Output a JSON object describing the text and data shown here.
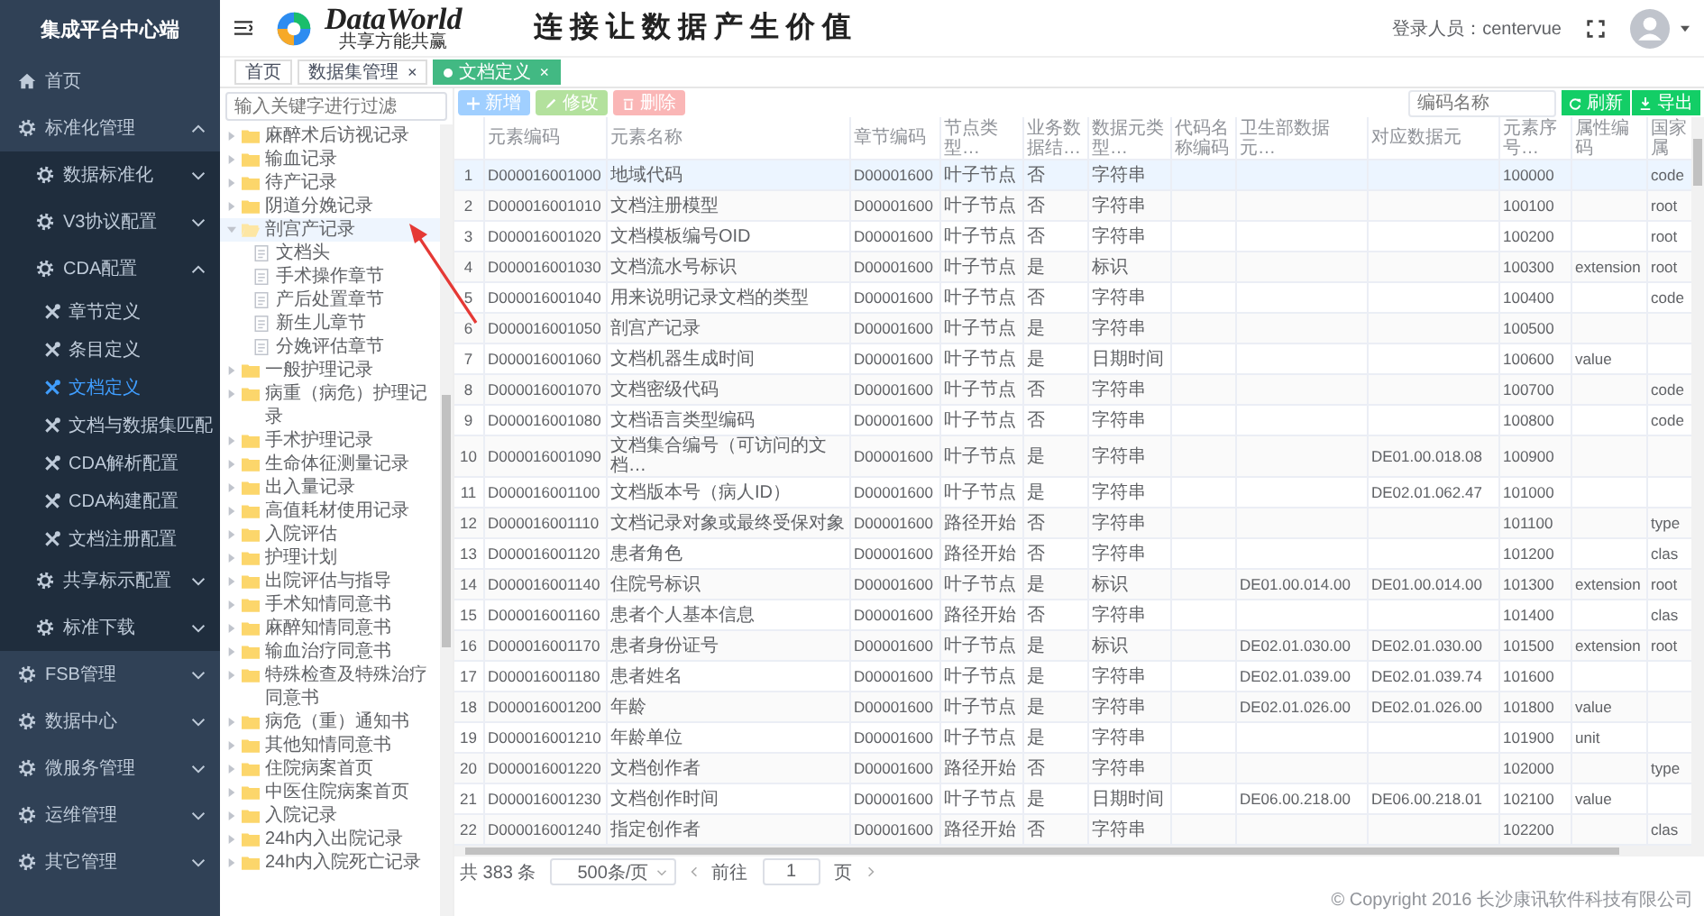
{
  "sidebar": {
    "title": "集成平台中心端",
    "items": [
      {
        "label": "首页",
        "kind": "page",
        "selected": false
      },
      {
        "label": "标准化管理",
        "kind": "menu",
        "expanded": true,
        "children": [
          {
            "label": "数据标准化",
            "kind": "menu",
            "expanded": false
          },
          {
            "label": "V3协议配置",
            "kind": "menu",
            "expanded": false
          },
          {
            "label": "CDA配置",
            "kind": "menu",
            "expanded": true,
            "children": [
              {
                "label": "章节定义",
                "kind": "page",
                "selected": false
              },
              {
                "label": "条目定义",
                "kind": "page",
                "selected": false
              },
              {
                "label": "文档定义",
                "kind": "page",
                "selected": true
              },
              {
                "label": "文档与数据集匹配",
                "kind": "page",
                "selected": false
              },
              {
                "label": "CDA解析配置",
                "kind": "page",
                "selected": false
              },
              {
                "label": "CDA构建配置",
                "kind": "page",
                "selected": false
              },
              {
                "label": "文档注册配置",
                "kind": "page",
                "selected": false
              }
            ]
          },
          {
            "label": "共享标示配置",
            "kind": "menu",
            "expanded": false
          },
          {
            "label": "标准下载",
            "kind": "menu",
            "expanded": false
          }
        ]
      },
      {
        "label": "FSB管理",
        "kind": "menu",
        "expanded": false
      },
      {
        "label": "数据中心",
        "kind": "menu",
        "expanded": false
      },
      {
        "label": "微服务管理",
        "kind": "menu",
        "expanded": false
      },
      {
        "label": "运维管理",
        "kind": "menu",
        "expanded": false
      },
      {
        "label": "其它管理",
        "kind": "menu",
        "expanded": false
      }
    ]
  },
  "header": {
    "logo_name": "DataWorld",
    "logo_tagline": "共享方能共赢",
    "slogan": "连接让数据产生价值",
    "user": "登录人员：centervue"
  },
  "tabs": [
    {
      "label": "首页",
      "selected": false
    },
    {
      "label": "数据集管理",
      "close": "×",
      "selected": false
    },
    {
      "label": "文档定义",
      "close": "×",
      "selected": true
    }
  ],
  "tree": {
    "placeholder": "输入关键字进行过滤",
    "items": [
      {
        "label": "麻醉术后访视记录",
        "kind": "folder",
        "expanded": false,
        "selected": false
      },
      {
        "label": "输血记录",
        "kind": "folder",
        "expanded": false,
        "selected": false
      },
      {
        "label": "待产记录",
        "kind": "folder",
        "expanded": false,
        "selected": false
      },
      {
        "label": "阴道分娩记录",
        "kind": "folder",
        "expanded": false,
        "selected": false
      },
      {
        "label": "剖宫产记录",
        "kind": "folder",
        "expanded": true,
        "selected": true,
        "children": [
          {
            "label": "文档头",
            "kind": "doc",
            "selected": false
          },
          {
            "label": "手术操作章节",
            "kind": "doc",
            "selected": false
          },
          {
            "label": "产后处置章节",
            "kind": "doc",
            "selected": false
          },
          {
            "label": "新生儿章节",
            "kind": "doc",
            "selected": false
          },
          {
            "label": "分娩评估章节",
            "kind": "doc",
            "selected": false
          }
        ]
      },
      {
        "label": "一般护理记录",
        "kind": "folder",
        "expanded": false,
        "selected": false
      },
      {
        "label": "病重（病危）护理记录",
        "kind": "folder",
        "expanded": false,
        "selected": false
      },
      {
        "label": "手术护理记录",
        "kind": "folder",
        "expanded": false,
        "selected": false
      },
      {
        "label": "生命体征测量记录",
        "kind": "folder",
        "expanded": false,
        "selected": false
      },
      {
        "label": "出入量记录",
        "kind": "folder",
        "expanded": false,
        "selected": false
      },
      {
        "label": "高值耗材使用记录",
        "kind": "folder",
        "expanded": false,
        "selected": false
      },
      {
        "label": "入院评估",
        "kind": "folder",
        "expanded": false,
        "selected": false
      },
      {
        "label": "护理计划",
        "kind": "folder",
        "expanded": false,
        "selected": false
      },
      {
        "label": "出院评估与指导",
        "kind": "folder",
        "expanded": false,
        "selected": false
      },
      {
        "label": "手术知情同意书",
        "kind": "folder",
        "expanded": false,
        "selected": false
      },
      {
        "label": "麻醉知情同意书",
        "kind": "folder",
        "expanded": false,
        "selected": false
      },
      {
        "label": "输血治疗同意书",
        "kind": "folder",
        "expanded": false,
        "selected": false
      },
      {
        "label": "特殊检查及特殊治疗同意书",
        "kind": "folder",
        "expanded": false,
        "selected": false
      },
      {
        "label": "病危（重）通知书",
        "kind": "folder",
        "expanded": false,
        "selected": false
      },
      {
        "label": "其他知情同意书",
        "kind": "folder",
        "expanded": false,
        "selected": false
      },
      {
        "label": "住院病案首页",
        "kind": "folder",
        "expanded": false,
        "selected": false
      },
      {
        "label": "中医住院病案首页",
        "kind": "folder",
        "expanded": false,
        "selected": false
      },
      {
        "label": "入院记录",
        "kind": "folder",
        "expanded": false,
        "selected": false
      },
      {
        "label": "24h内入出院记录",
        "kind": "folder",
        "expanded": false,
        "selected": false
      },
      {
        "label": "24h内入院死亡记录",
        "kind": "folder",
        "expanded": false,
        "selected": false
      }
    ]
  },
  "toolbar": {
    "buttons": [
      {
        "label": "新增",
        "kind": "add"
      },
      {
        "label": "修改",
        "kind": "edit"
      },
      {
        "label": "删除",
        "kind": "delete"
      }
    ],
    "search": {
      "placeholder": "编码名称"
    },
    "actions": [
      {
        "label": "刷新",
        "kind": "refresh"
      },
      {
        "label": "导出",
        "kind": "export"
      }
    ]
  },
  "table": {
    "columns": [
      {
        "kind": "index"
      },
      {
        "label": "元素编码",
        "kind": "code"
      },
      {
        "label": "元素名称",
        "kind": "text"
      },
      {
        "label": "章节编码",
        "kind": "code"
      },
      {
        "label": "节点类型…",
        "kind": "text"
      },
      {
        "label": "业务数据结…",
        "kind": "text"
      },
      {
        "label": "数据元类型…",
        "kind": "text"
      },
      {
        "label": "代码名称编码",
        "kind": "text"
      },
      {
        "label": "卫生部数据元…",
        "kind": "code"
      },
      {
        "label": "对应数据元",
        "kind": "code"
      },
      {
        "label": "元素序号…",
        "kind": "code"
      },
      {
        "label": "属性编码",
        "kind": "code"
      },
      {
        "label": "国家属",
        "kind": "code"
      }
    ],
    "rows": [
      {
        "selected": true,
        "cells": [
          "1",
          "D000016001000",
          "地域代码",
          "D00001600",
          "叶子节点",
          "否",
          "字符串",
          null,
          null,
          null,
          "100000",
          null,
          "code"
        ]
      },
      {
        "selected": false,
        "cells": [
          "2",
          "D000016001010",
          "文档注册模型",
          "D00001600",
          "叶子节点",
          "否",
          "字符串",
          null,
          null,
          null,
          "100100",
          null,
          "root"
        ]
      },
      {
        "selected": false,
        "cells": [
          "3",
          "D000016001020",
          "文档模板编号OID",
          "D00001600",
          "叶子节点",
          "否",
          "字符串",
          null,
          null,
          null,
          "100200",
          null,
          "root"
        ]
      },
      {
        "selected": false,
        "cells": [
          "4",
          "D000016001030",
          "文档流水号标识",
          "D00001600",
          "叶子节点",
          "是",
          "标识",
          null,
          null,
          null,
          "100300",
          "extension",
          "root"
        ]
      },
      {
        "selected": false,
        "cells": [
          "5",
          "D000016001040",
          "用来说明记录文档的类型",
          "D00001600",
          "叶子节点",
          "否",
          "字符串",
          null,
          null,
          null,
          "100400",
          null,
          "code"
        ]
      },
      {
        "selected": false,
        "cells": [
          "6",
          "D000016001050",
          "剖宫产记录",
          "D00001600",
          "叶子节点",
          "是",
          "字符串",
          null,
          null,
          null,
          "100500",
          null,
          null
        ]
      },
      {
        "selected": false,
        "cells": [
          "7",
          "D000016001060",
          "文档机器生成时间",
          "D00001600",
          "叶子节点",
          "是",
          "日期时间",
          null,
          null,
          null,
          "100600",
          "value",
          null
        ]
      },
      {
        "selected": false,
        "cells": [
          "8",
          "D000016001070",
          "文档密级代码",
          "D00001600",
          "叶子节点",
          "否",
          "字符串",
          null,
          null,
          null,
          "100700",
          null,
          "code"
        ]
      },
      {
        "selected": false,
        "cells": [
          "9",
          "D000016001080",
          "文档语言类型编码",
          "D00001600",
          "叶子节点",
          "否",
          "字符串",
          null,
          null,
          null,
          "100800",
          null,
          "code"
        ]
      },
      {
        "selected": false,
        "cells": [
          "10",
          "D000016001090",
          "文档集合编号（可访问的文档…",
          "D00001600",
          "叶子节点",
          "是",
          "字符串",
          null,
          null,
          "DE01.00.018.08",
          "100900",
          null,
          null
        ]
      },
      {
        "selected": false,
        "cells": [
          "11",
          "D000016001100",
          "文档版本号（病人ID）",
          "D00001600",
          "叶子节点",
          "是",
          "字符串",
          null,
          null,
          "DE02.01.062.47",
          "101000",
          null,
          null
        ]
      },
      {
        "selected": false,
        "cells": [
          "12",
          "D000016001110",
          "文档记录对象或最终受保对象",
          "D00001600",
          "路径开始",
          "否",
          "字符串",
          null,
          null,
          null,
          "101100",
          null,
          "type"
        ]
      },
      {
        "selected": false,
        "cells": [
          "13",
          "D000016001120",
          "患者角色",
          "D00001600",
          "路径开始",
          "否",
          "字符串",
          null,
          null,
          null,
          "101200",
          null,
          "clas"
        ]
      },
      {
        "selected": false,
        "cells": [
          "14",
          "D000016001140",
          "住院号标识",
          "D00001600",
          "叶子节点",
          "是",
          "标识",
          null,
          "DE01.00.014.00",
          "DE01.00.014.00",
          "101300",
          "extension",
          "root"
        ]
      },
      {
        "selected": false,
        "cells": [
          "15",
          "D000016001160",
          "患者个人基本信息",
          "D00001600",
          "路径开始",
          "否",
          "字符串",
          null,
          null,
          null,
          "101400",
          null,
          "clas"
        ]
      },
      {
        "selected": false,
        "cells": [
          "16",
          "D000016001170",
          "患者身份证号",
          "D00001600",
          "叶子节点",
          "是",
          "标识",
          null,
          "DE02.01.030.00",
          "DE02.01.030.00",
          "101500",
          "extension",
          "root"
        ]
      },
      {
        "selected": false,
        "cells": [
          "17",
          "D000016001180",
          "患者姓名",
          "D00001600",
          "叶子节点",
          "是",
          "字符串",
          null,
          "DE02.01.039.00",
          "DE02.01.039.74",
          "101600",
          null,
          null
        ]
      },
      {
        "selected": false,
        "cells": [
          "18",
          "D000016001200",
          "年龄",
          "D00001600",
          "叶子节点",
          "是",
          "字符串",
          null,
          "DE02.01.026.00",
          "DE02.01.026.00",
          "101800",
          "value",
          null
        ]
      },
      {
        "selected": false,
        "cells": [
          "19",
          "D000016001210",
          "年龄单位",
          "D00001600",
          "叶子节点",
          "是",
          "字符串",
          null,
          null,
          null,
          "101900",
          "unit",
          null
        ]
      },
      {
        "selected": false,
        "cells": [
          "20",
          "D000016001220",
          "文档创作者",
          "D00001600",
          "路径开始",
          "否",
          "字符串",
          null,
          null,
          null,
          "102000",
          null,
          "type"
        ]
      },
      {
        "selected": false,
        "cells": [
          "21",
          "D000016001230",
          "文档创作时间",
          "D00001600",
          "叶子节点",
          "是",
          "日期时间",
          null,
          "DE06.00.218.00",
          "DE06.00.218.01",
          "102100",
          "value",
          null
        ]
      },
      {
        "selected": false,
        "cells": [
          "22",
          "D000016001240",
          "指定创作者",
          "D00001600",
          "路径开始",
          "否",
          "字符串",
          null,
          null,
          null,
          "102200",
          null,
          "clas"
        ]
      }
    ]
  },
  "pagination": {
    "total": "共 383 条",
    "page_size": "500条/页",
    "goto": "前往",
    "page": "1",
    "page_unit": "页"
  },
  "copyright": "© Copyright 2016 长沙康讯软件科技有限公司"
}
